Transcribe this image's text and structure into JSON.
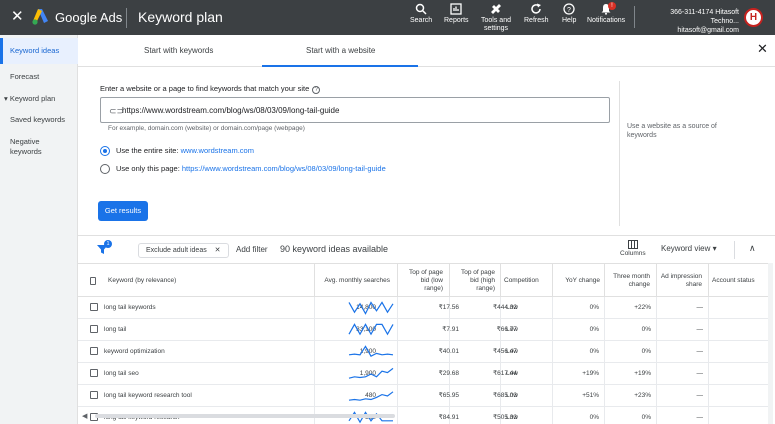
{
  "header": {
    "app_name": "Google Ads",
    "page_title": "Keyword plan",
    "tools": [
      {
        "label": "Search",
        "icon": "search-icon"
      },
      {
        "label": "Reports",
        "icon": "reports-icon"
      },
      {
        "label": "Tools and settings",
        "icon": "wrench-icon"
      },
      {
        "label": "Refresh",
        "icon": "refresh-icon"
      },
      {
        "label": "Help",
        "icon": "help-icon"
      },
      {
        "label": "Notifications",
        "icon": "bell-icon"
      }
    ],
    "notification_count": "!",
    "account_id": "366-311-4174 Hitasoft Techno...",
    "account_email": "hitasoft@gmail.com",
    "avatar_letter": "H"
  },
  "sidebar": {
    "items": [
      {
        "label": "Keyword ideas",
        "active": true
      },
      {
        "label": "Forecast"
      },
      {
        "label": "Keyword plan"
      },
      {
        "label": "Saved keywords"
      },
      {
        "label": "Negative keywords"
      }
    ]
  },
  "tabs": [
    "Start with keywords",
    "Start with a website"
  ],
  "form": {
    "intro": "Enter a website or a page to find keywords that match your site",
    "url_value": "https://www.wordstream.com/blog/ws/08/03/09/long-tail-guide",
    "example": "For example, domain.com (website) or domain.com/page (webpage)",
    "side_hint": "Use a website as a source of keywords",
    "option_site_label": "Use the entire site:",
    "option_site_value": "www.wordstream.com",
    "option_page_label": "Use only this page:",
    "option_page_value": "https://www.wordstream.com/blog/ws/08/03/09/long-tail-guide",
    "get_results": "Get results"
  },
  "filter_bar": {
    "badge": "1",
    "chip": "Exclude adult ideas",
    "add_filter": "Add filter",
    "ideas_count": "90 keyword ideas available",
    "columns": "Columns",
    "keyword_view": "Keyword view"
  },
  "table": {
    "headers": {
      "keyword": "Keyword (by relevance)",
      "searches": "Avg. monthly searches",
      "bid_low": "Top of page bid (low range)",
      "bid_high": "Top of page bid (high range)",
      "competition": "Competition",
      "yoy": "YoY change",
      "three_month": "Three month change",
      "impression": "Ad impression share",
      "status": "Account status"
    },
    "rows": [
      {
        "keyword": "long tail keywords",
        "searches": "14,800",
        "bid_low": "₹17.56",
        "bid_high": "₹444.32",
        "competition": "Low",
        "yoy": "0%",
        "three_month": "+22%",
        "impression": "—",
        "trend": [
          0.9,
          0.2,
          0.8,
          0.1,
          0.9,
          0.3,
          0.9,
          0.2,
          0.8
        ]
      },
      {
        "keyword": "long tail",
        "searches": "33,100",
        "bid_low": "₹7.91",
        "bid_high": "₹66.77",
        "competition": "Low",
        "yoy": "0%",
        "three_month": "0%",
        "impression": "—",
        "trend": [
          0.2,
          0.9,
          0.2,
          0.9,
          0.2,
          0.9,
          0.9,
          0.2,
          0.9
        ]
      },
      {
        "keyword": "keyword optimization",
        "searches": "1,900",
        "bid_low": "₹40.01",
        "bid_high": "₹456.47",
        "competition": "Low",
        "yoy": "0%",
        "three_month": "0%",
        "impression": "—",
        "trend": [
          0.3,
          0.35,
          0.3,
          0.9,
          0.2,
          0.4,
          0.3,
          0.35,
          0.3
        ]
      },
      {
        "keyword": "long tail seo",
        "searches": "1,900",
        "bid_low": "₹29.68",
        "bid_high": "₹617.44",
        "competition": "Low",
        "yoy": "+19%",
        "three_month": "+19%",
        "impression": "—",
        "trend": [
          0.2,
          0.3,
          0.25,
          0.3,
          0.5,
          0.3,
          0.7,
          0.6,
          0.9
        ]
      },
      {
        "keyword": "long tail keyword research tool",
        "searches": "480",
        "bid_low": "₹65.95",
        "bid_high": "₹685.03",
        "competition": "Low",
        "yoy": "+51%",
        "three_month": "+23%",
        "impression": "—",
        "trend": [
          0.2,
          0.25,
          0.2,
          0.3,
          0.25,
          0.4,
          0.6,
          0.5,
          0.8
        ]
      },
      {
        "keyword": "long tail keyword research",
        "searches": "880",
        "bid_low": "₹84.91",
        "bid_high": "₹505.33",
        "competition": "Low",
        "yoy": "0%",
        "three_month": "0%",
        "impression": "—",
        "trend": [
          0.3,
          0.9,
          0.2,
          0.9,
          0.3,
          0.8,
          0.3,
          0.3,
          0.3
        ]
      }
    ]
  },
  "colors": {
    "accent": "#1a73e8",
    "header_bg": "#3c4043",
    "spark": "#1a73e8"
  }
}
